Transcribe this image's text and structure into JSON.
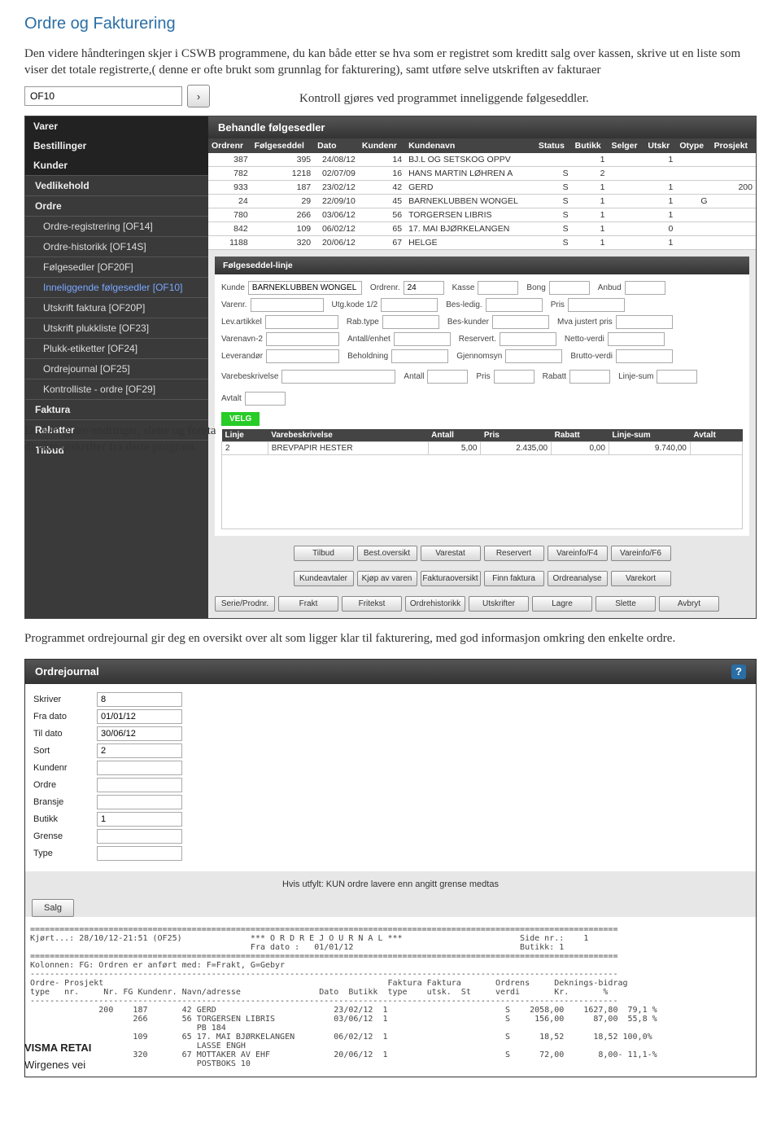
{
  "title": "Ordre og Fakturering",
  "intro": "Den videre håndteringen skjer i CSWB programmene, du kan både etter se hva som er registret som kreditt salg over kassen, skrive ut en liste som viser det totale registrerte,( denne er ofte brukt som grunnlag for fakturering), samt utføre selve utskriften av fakturaer",
  "of10": {
    "value": "OF10",
    "go": "›"
  },
  "kontroll": "Kontroll gjøres ved programmet inneliggende følgeseddler.",
  "sidebar": {
    "top": [
      "Varer",
      "Bestillinger",
      "Kunder"
    ],
    "sections": [
      {
        "label": "Vedlikehold",
        "bold": true
      },
      {
        "label": "Ordre",
        "bold": true
      },
      {
        "label": "Ordre-registrering [OF14]",
        "sub": true
      },
      {
        "label": "Ordre-historikk [OF14S]",
        "sub": true
      },
      {
        "label": "Følgesedler [OF20F]",
        "sub": true
      },
      {
        "label": "Inneliggende følgesedler [OF10]",
        "sub": true,
        "hl": true
      },
      {
        "label": "Utskrift faktura [OF20P]",
        "sub": true
      },
      {
        "label": "Utskrift plukkliste [OF23]",
        "sub": true
      },
      {
        "label": "Plukk-etiketter [OF24]",
        "sub": true
      },
      {
        "label": "Ordrejournal [OF25]",
        "sub": true
      },
      {
        "label": "Kontrolliste - ordre [OF29]",
        "sub": true
      },
      {
        "label": "Faktura",
        "bold": true
      },
      {
        "label": "Rabatter",
        "bold": true
      },
      {
        "label": "Tilbud",
        "bold": true
      }
    ]
  },
  "behandle": {
    "title": "Behandle følgesedler",
    "headers": [
      "Ordrenr",
      "Følgeseddel",
      "Dato",
      "Kundenr",
      "Kundenavn",
      "Status",
      "Butikk",
      "Selger",
      "Utskr",
      "Otype",
      "Prosjekt"
    ],
    "rows": [
      [
        "387",
        "395",
        "24/08/12",
        "14",
        "BJ.L OG SETSKOG OPPV",
        "",
        "1",
        "",
        "1",
        "",
        ""
      ],
      [
        "782",
        "1218",
        "02/07/09",
        "16",
        "HANS MARTIN LØHREN A",
        "S",
        "2",
        "",
        "",
        "",
        ""
      ],
      [
        "933",
        "187",
        "23/02/12",
        "42",
        "GERD",
        "S",
        "1",
        "",
        "1",
        "",
        "200"
      ],
      [
        "24",
        "29",
        "22/09/10",
        "45",
        "BARNEKLUBBEN WONGEL",
        "S",
        "1",
        "",
        "1",
        "G",
        ""
      ],
      [
        "780",
        "266",
        "03/06/12",
        "56",
        "TORGERSEN LIBRIS",
        "S",
        "1",
        "",
        "1",
        "",
        ""
      ],
      [
        "842",
        "109",
        "06/02/12",
        "65",
        "17. MAI BJØRKELANGEN",
        "S",
        "1",
        "",
        "0",
        "",
        ""
      ],
      [
        "1188",
        "320",
        "20/06/12",
        "67",
        "HELGE",
        "S",
        "1",
        "",
        "1",
        "",
        ""
      ]
    ]
  },
  "fslinje": {
    "title": "Følgeseddel-linje",
    "kunde_lab": "Kunde",
    "kunde": "BARNEKLUBBEN WONGEL",
    "fields": {
      "ordrenr_lab": "Ordrenr.",
      "ordrenr": "24",
      "kasse_lab": "Kasse",
      "bong_lab": "Bong",
      "anbud_lab": "Anbud",
      "varenr_lab": "Varenr.",
      "utgkode_lab": "Utg.kode 1/2",
      "besledig_lab": "Bes-ledig.",
      "pris_lab": "Pris",
      "levartikkel_lab": "Lev.artikkel",
      "rabtype_lab": "Rab.type",
      "beskunder_lab": "Bes-kunder",
      "mvajust_lab": "Mva justert pris",
      "varenavn2_lab": "Varenavn-2",
      "antallenhet_lab": "Antall/enhet",
      "reservert_lab": "Reservert.",
      "nettoverdi_lab": "Netto-verdi",
      "leverandor_lab": "Leverandør",
      "beholdning_lab": "Beholdning",
      "gjennomsyn_lab": "Gjennomsyn",
      "bruttoverdi_lab": "Brutto-verdi",
      "varebeskrivelse_lab": "Varebeskrivelse",
      "antall_lab": "Antall",
      "pris2_lab": "Pris",
      "rabatt_lab": "Rabatt",
      "linjesum_lab": "Linje-sum",
      "avtalt_lab": "Avtalt"
    },
    "velg": "VELG",
    "line_headers": [
      "Linje",
      "Varebeskrivelse",
      "Antall",
      "Pris",
      "Rabatt",
      "Linje-sum",
      "Avtalt"
    ],
    "line": [
      "2",
      "BREVPAPIR HESTER",
      "5,00",
      "2.435,00",
      "0,00",
      "9.740,00",
      ""
    ]
  },
  "buttons": {
    "row1": [
      "Tilbud",
      "Best.oversikt",
      "Varestat",
      "Reservert",
      "Vareinfo/F4",
      "Vareinfo/F6"
    ],
    "row2": [
      "Kundeavtaler",
      "Kjøp av varen",
      "Fakturaoversikt",
      "Finn faktura",
      "Ordreanalyse",
      "Varekort"
    ],
    "row3": [
      "Serie/Prodnr.",
      "Frakt",
      "Fritekst",
      "Ordrehistorikk",
      "Utskrifter",
      "Lagre",
      "Slette",
      "Avbryt"
    ]
  },
  "mid_p1": "Du kan gjøre endringer, slette og foreta direkte utskrifter fra dette program.",
  "mid_p2": "Programmet ordrejournal gir deg en oversikt over alt som ligger klar til fakturering, med god informasjon omkring den enkelte ordre.",
  "oj": {
    "title": "Ordrejournal",
    "fields": [
      {
        "lab": "Skriver",
        "val": "8"
      },
      {
        "lab": "Fra dato",
        "val": "01/01/12"
      },
      {
        "lab": "Til dato",
        "val": "30/06/12"
      },
      {
        "lab": "Sort",
        "val": "2"
      },
      {
        "lab": "Kundenr",
        "val": ""
      },
      {
        "lab": "Ordre",
        "val": ""
      },
      {
        "lab": "Bransje",
        "val": ""
      },
      {
        "lab": "Butikk",
        "val": "1"
      },
      {
        "lab": "Grense",
        "val": ""
      },
      {
        "lab": "Type",
        "val": ""
      }
    ],
    "foot": "Hvis utfylt: KUN ordre lavere enn angitt grense medtas",
    "salg": "Salg"
  },
  "report": {
    "run": "Kjørt...: 28/10/12-21:51 (OF25)",
    "title": "*** O R D R E J O U R N A L ***",
    "side": "Side nr.:    1",
    "fra": "Fra dato :   01/01/12",
    "butikk": "Butikk: 1",
    "kol": "Kolonnen: FG: Ordren er anført med: F=Frakt, G=Gebyr",
    "hdr1": "Ordre- Prosjekt                                                          Faktura Faktura       Ordrens     Deknings-bidrag",
    "hdr2": "type   nr.     Nr. FG Kundenr. Navn/adresse                Dato  Butikk  type    utsk.  St     verdi       Kr.       %",
    "lines": [
      "              200    187       42 GERD                        23/02/12  1                        S    2058,00    1627,80  79,1 %",
      "                     266       56 TORGERSEN LIBRIS            03/06/12  1                        S     156,00      87,00  55,8 %",
      "                                  PB 184",
      "                     109       65 17. MAI BJØRKELANGEN        06/02/12  1                        S      18,52      18,52 100,0%",
      "                                  LASSE ENGH",
      "                     320       67 MOTTAKER AV EHF             20/06/12  1                        S      72,00       8,00- 11,1-%",
      "                                  POSTBOKS 10"
    ]
  },
  "visma": {
    "l1": "VISMA RETAI",
    "l2": "Wirgenes vei"
  }
}
